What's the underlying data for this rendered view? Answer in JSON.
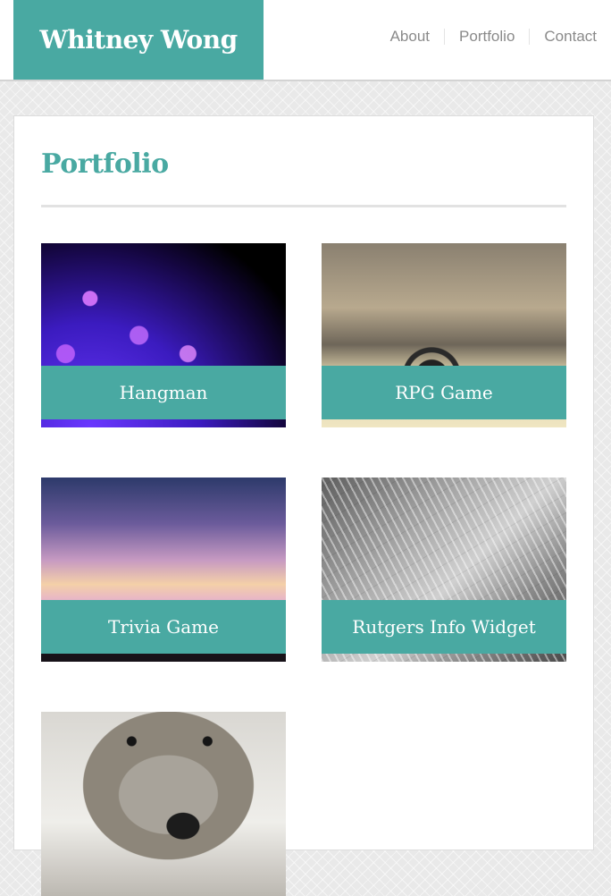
{
  "header": {
    "brand": "Whitney Wong",
    "nav": [
      "About",
      "Portfolio",
      "Contact"
    ]
  },
  "main": {
    "title": "Portfolio",
    "projects": [
      {
        "label": "Hangman",
        "image": "fiber-optic-lights"
      },
      {
        "label": "RPG Game",
        "image": "headphones-on-desk"
      },
      {
        "label": "Trivia Game",
        "image": "sunset-over-sea"
      },
      {
        "label": "Rutgers Info Widget",
        "image": "leaf-closeup"
      },
      {
        "label": "",
        "image": "dog-face"
      }
    ]
  },
  "colors": {
    "accent": "#49a9a2",
    "nav_text": "#8a8a8a",
    "background": "#e9e9e9"
  }
}
